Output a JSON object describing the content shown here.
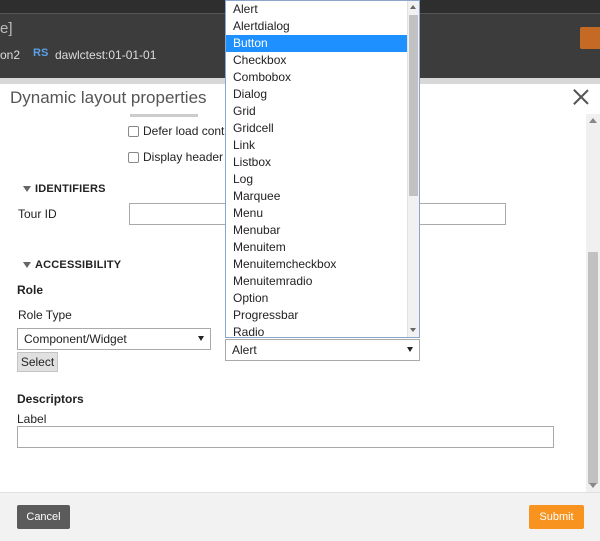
{
  "app_header": {
    "title_fragment": "e]",
    "name_fragment": "on2",
    "ruleset_badge": "RS",
    "ruleset_version": "dawlctest:01-01-01"
  },
  "modal": {
    "title": "Dynamic layout properties",
    "defer_load_label": "Defer load cont",
    "display_header_label": "Display header",
    "identifiers": {
      "heading": "IDENTIFIERS",
      "tour_id_label": "Tour ID",
      "tour_id_value": ""
    },
    "accessibility": {
      "heading": "ACCESSIBILITY",
      "role_label": "Role",
      "role_type_label": "Role Type",
      "role_type_value": "Component/Widget",
      "role_value": "Alert",
      "select_button": "Select",
      "descriptors_label": "Descriptors",
      "label_field_label": "Label",
      "label_field_value": ""
    },
    "footer": {
      "cancel": "Cancel",
      "submit": "Submit"
    }
  },
  "role_dropdown": {
    "selected": "Button",
    "options": [
      "Alert",
      "Alertdialog",
      "Button",
      "Checkbox",
      "Combobox",
      "Dialog",
      "Grid",
      "Gridcell",
      "Link",
      "Listbox",
      "Log",
      "Marquee",
      "Menu",
      "Menubar",
      "Menuitem",
      "Menuitemcheckbox",
      "Menuitemradio",
      "Option",
      "Progressbar",
      "Radio"
    ]
  }
}
